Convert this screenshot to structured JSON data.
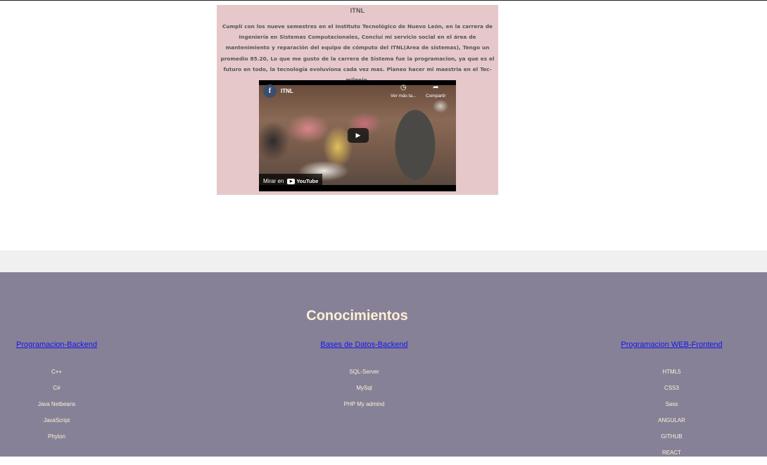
{
  "itnl": {
    "title": "ITNL",
    "description": "Cumplí con los nueve semestres en el Instituto Tecnológico de Nuevo León, en la carrera de Ingeniería en Sistemas Computacionales, Concluí mi servicio social en el área de mantenimiento y reparación del equipo de cómputo del ITNL(Area de sistemas), Tengo un promedio 85.20, Lo que me gusto de la carrera de Sistema fue la programacion, ya que es el futuro en todo, la tecnología evoluviona cada vez mas. Planeo hacer mi maestria en el Tec-milenio."
  },
  "video": {
    "channel_initial": "f",
    "title": "ITNL",
    "watch_later_label": "Ver más ta...",
    "share_label": "Compartir",
    "watch_on_label": "Mirar en",
    "youtube_label": "YouTube",
    "watch_later_icon": "clock-icon",
    "share_icon": "share-arrow-icon",
    "play_icon": "play-icon"
  },
  "knowledge": {
    "title": "Conocimientos",
    "columns": [
      {
        "heading": "Programacion-Backend",
        "items": [
          "C++",
          "C#",
          "Java Netbeans",
          "JavaScript",
          "Phyton"
        ]
      },
      {
        "heading": "Bases de Datos-Backend",
        "items": [
          "SQL-Server",
          "MySql",
          "PHP My admind"
        ]
      },
      {
        "heading": "Programacion WEB-Frontend",
        "items": [
          "HTML5",
          "CSS3",
          "Sass",
          "ANGULAR",
          "GITHUB",
          "REACT"
        ]
      }
    ]
  },
  "colors": {
    "card_background": "#e6c8ca",
    "knowledge_background": "#878198",
    "heading_text": "#fdf0d5",
    "link": "#1515ee"
  }
}
